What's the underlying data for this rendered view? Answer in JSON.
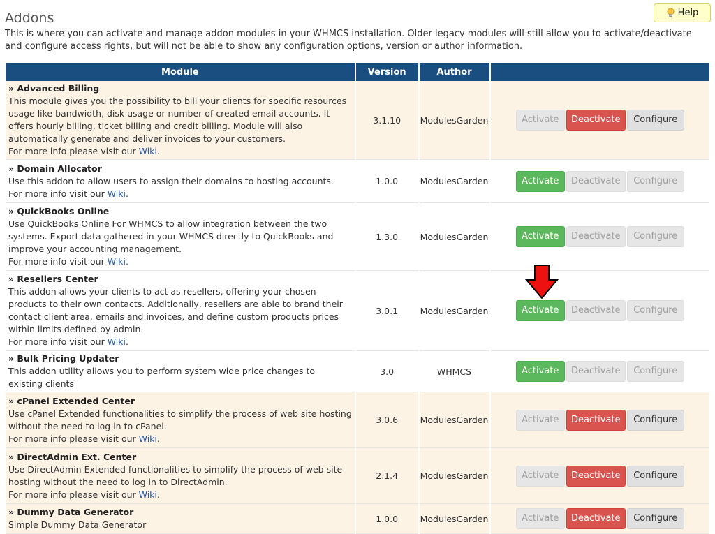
{
  "page": {
    "title": "Addons",
    "help_label": "Help",
    "intro": "This is where you can activate and manage addon modules in your WHMCS installation. Older legacy modules will still allow you to activate/deactivate and configure access rights, but will not be able to show any configuration options, version or author information."
  },
  "table": {
    "headers": {
      "module": "Module",
      "version": "Version",
      "author": "Author"
    },
    "buttons": {
      "activate": "Activate",
      "deactivate": "Deactivate",
      "configure": "Configure"
    },
    "rows": [
      {
        "name": "» Advanced Billing",
        "description": "This module gives you the possibility to bill your clients for specific resources usage like bandwidth, disk usage or number of created email accounts. It offers hourly billing, ticket billing and credit billing. Module will also automatically generate and deliver invoices to your customers.",
        "more_prefix": "For more info please visit our ",
        "more_link": "Wiki",
        "more_suffix": ".",
        "version": "3.1.10",
        "author": "ModulesGarden",
        "state": "active"
      },
      {
        "name": "» Domain Allocator",
        "description": "Use this addon to allow users to assign their domains to hosting accounts.",
        "more_prefix": "For more info visit our ",
        "more_link": "Wiki",
        "more_suffix": ".",
        "version": "1.0.0",
        "author": "ModulesGarden",
        "state": "inactive"
      },
      {
        "name": "» QuickBooks Online",
        "description": "Use QuickBooks Online For WHMCS to allow integration between the two systems. Export data gathered in your WHMCS directly to QuickBooks and improve your accounting management.",
        "more_prefix": "For more info visit our ",
        "more_link": "Wiki.",
        "more_suffix": "",
        "version": "1.3.0",
        "author": "ModulesGarden",
        "state": "inactive"
      },
      {
        "name": "» Resellers Center",
        "description": "This addon allows your clients to act as resellers, offering your chosen products to their own contacts. Additionally, resellers are able to brand their contact client area, emails and invoices, and define custom products prices within limits defined by admin.",
        "more_prefix": "For more info visit our ",
        "more_link": "Wiki",
        "more_suffix": ".",
        "version": "3.0.1",
        "author": "ModulesGarden",
        "state": "inactive"
      },
      {
        "name": "» Bulk Pricing Updater",
        "description": "This addon utility allows you to perform system wide price changes to existing clients",
        "more_prefix": "",
        "more_link": "",
        "more_suffix": "",
        "version": "3.0",
        "author": "WHMCS",
        "state": "inactive"
      },
      {
        "name": "» cPanel Extended Center",
        "description": "Use cPanel Extended functionalities to simplify the process of web site hosting without the need to log in to cPanel.",
        "more_prefix": "For more info please visit our ",
        "more_link": "Wiki",
        "more_suffix": ".",
        "version": "3.0.6",
        "author": "ModulesGarden",
        "state": "active"
      },
      {
        "name": "» DirectAdmin Ext. Center",
        "description": "Use DirectAdmin Extended functionalities to simplify the process of web site hosting without the need to log in to DirectAdmin.",
        "more_prefix": "For more info please visit our ",
        "more_link": "Wiki",
        "more_suffix": ".",
        "version": "2.1.4",
        "author": "ModulesGarden",
        "state": "active"
      },
      {
        "name": "» Dummy Data Generator",
        "description": "Simple Dummy Data Generator",
        "more_prefix": "",
        "more_link": "",
        "more_suffix": "",
        "version": "1.0.0",
        "author": "ModulesGarden",
        "state": "active"
      }
    ]
  },
  "colors": {
    "header_bg": "#1a4d80",
    "active_row_bg": "#fcf3e5",
    "activate_green": "#5cb85c",
    "deactivate_red": "#d9534f",
    "highlight_arrow": "#ee1111"
  }
}
